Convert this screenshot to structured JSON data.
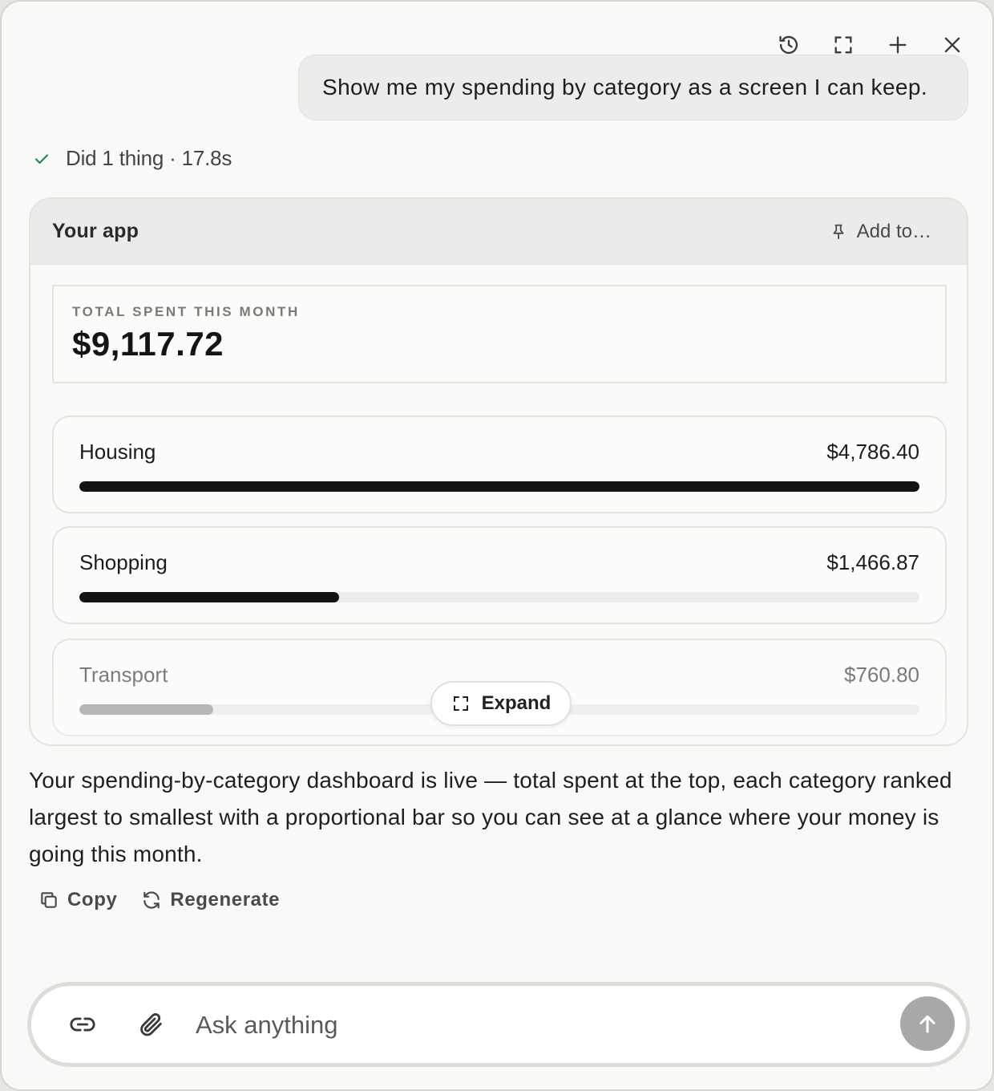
{
  "toolbar": {
    "icons": [
      "history-icon",
      "fullscreen-icon",
      "plus-icon",
      "close-icon"
    ]
  },
  "user_message": "Show me my spending by category as a screen I can keep.",
  "status": {
    "text": "Did 1 thing · 17.8s",
    "icon": "check-icon",
    "color": "#1f8a55"
  },
  "app": {
    "title": "Your app",
    "add_to_label": "Add to…",
    "total": {
      "label": "TOTAL SPENT THIS MONTH",
      "value": "$9,117.72"
    },
    "categories": [
      {
        "name": "Housing",
        "amount": "$4,786.40",
        "fraction": 1.0
      },
      {
        "name": "Shopping",
        "amount": "$1,466.87",
        "fraction": 0.309
      },
      {
        "name": "Transport",
        "amount": "$760.80",
        "fraction": 0.159
      }
    ],
    "expand_label": "Expand"
  },
  "assistant_message": "Your spending-by-category dashboard is live — total spent at the top, each category ranked largest to smallest with a proportional bar so you can see at a glance where your money is going this month.",
  "actions": {
    "copy_label": "Copy",
    "regenerate_label": "Regenerate"
  },
  "composer": {
    "placeholder": "Ask anything",
    "value": ""
  },
  "colors": {
    "bar_fill": "#121212",
    "bar_fill_faded": "#a3a3a1",
    "send_button": "#a8a8a6"
  }
}
